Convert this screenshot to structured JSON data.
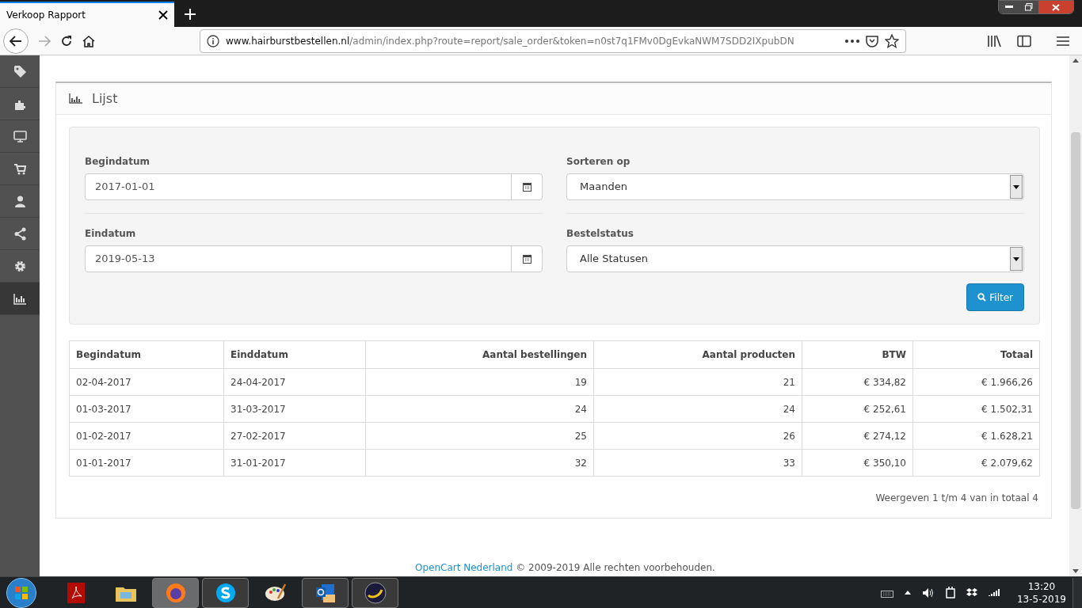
{
  "browser": {
    "tab_title": "Verkoop Rapport",
    "url_host": "www.hairburstbestellen.nl",
    "url_path": "/admin/index.php?route=report/sale_order&token=n0st7q1FMv0DgEvkaNWM7SDD2IXpubDN"
  },
  "sidebar": {
    "items": [
      {
        "selected": false
      },
      {
        "selected": false
      },
      {
        "selected": false
      },
      {
        "selected": false
      },
      {
        "selected": false
      },
      {
        "selected": false
      },
      {
        "selected": false
      },
      {
        "selected": true
      }
    ]
  },
  "panel": {
    "title": "Lijst"
  },
  "filter": {
    "fields": [
      {
        "kind": "date",
        "label": "Begindatum",
        "value": "2017-01-01"
      },
      {
        "kind": "select",
        "label": "Sorteren op",
        "value": "Maanden"
      },
      {
        "kind": "date",
        "label": "Eindatum",
        "value": "2019-05-13"
      },
      {
        "kind": "select",
        "label": "Bestelstatus",
        "value": "Alle Statusen"
      }
    ],
    "button": "Filter"
  },
  "table": {
    "columns": [
      "Begindatum",
      "Einddatum",
      "Aantal bestellingen",
      "Aantal producten",
      "BTW",
      "Totaal"
    ],
    "rows": [
      [
        "02-04-2017",
        "24-04-2017",
        "19",
        "21",
        "€ 334,82",
        "€ 1.966,26"
      ],
      [
        "01-03-2017",
        "31-03-2017",
        "24",
        "24",
        "€ 252,61",
        "€ 1.502,31"
      ],
      [
        "01-02-2017",
        "27-02-2017",
        "25",
        "26",
        "€ 274,12",
        "€ 1.628,21"
      ],
      [
        "01-01-2017",
        "31-01-2017",
        "32",
        "33",
        "€ 350,10",
        "€ 2.079,62"
      ]
    ]
  },
  "pagination": "Weergeven 1 t/m 4 van in totaal 4",
  "footer": {
    "link": "OpenCart Nederland",
    "text": "© 2009-2019 Alle rechten voorbehouden."
  },
  "taskbar": {
    "apps": [
      {
        "running": false,
        "selected": false
      },
      {
        "running": false,
        "selected": false
      },
      {
        "running": true,
        "selected": true
      },
      {
        "running": true,
        "selected": false
      },
      {
        "running": false,
        "selected": false
      },
      {
        "running": true,
        "selected": false
      },
      {
        "running": true,
        "selected": false
      }
    ],
    "time": "13:20",
    "date": "13-5-2019"
  }
}
